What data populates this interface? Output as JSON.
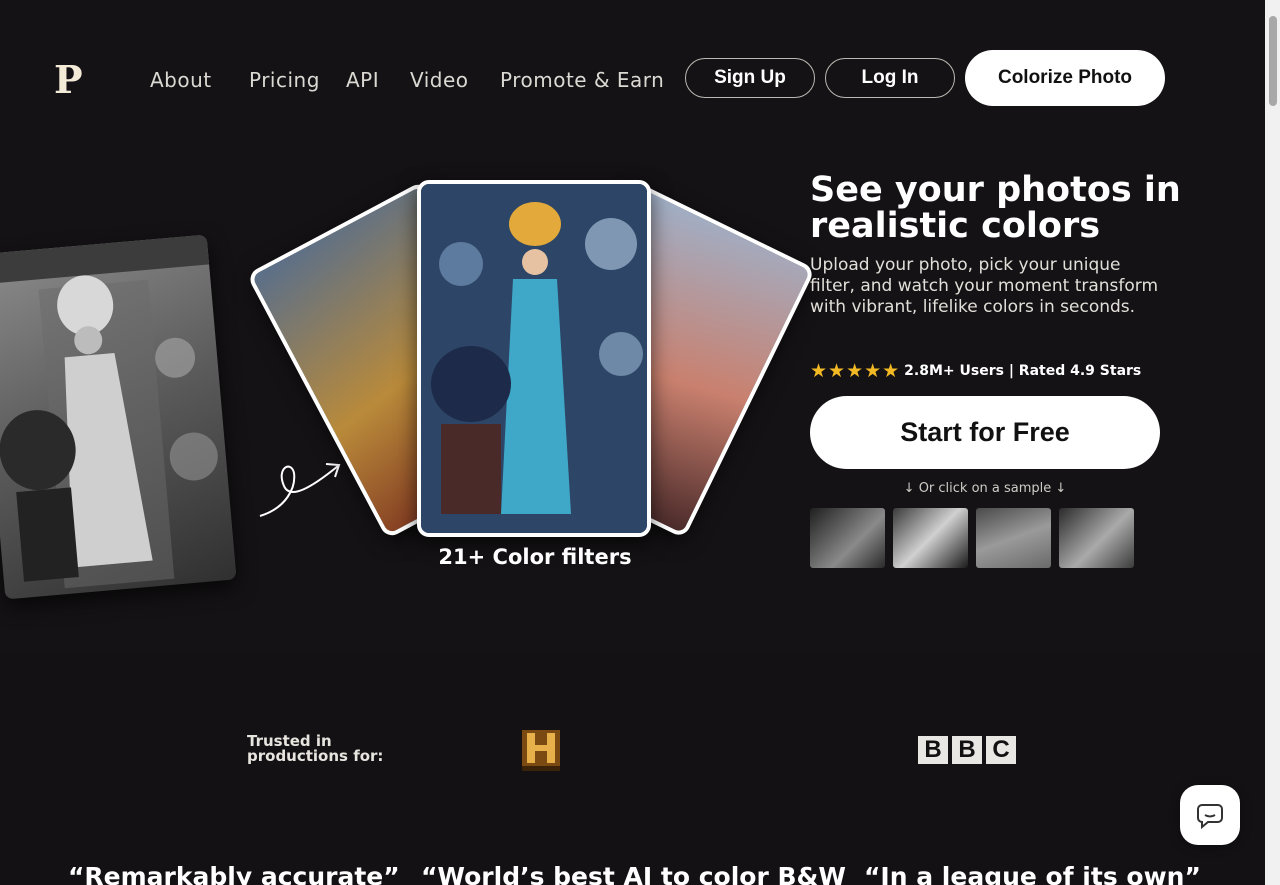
{
  "header": {
    "logo": "P",
    "nav": [
      "About",
      "Pricing",
      "API",
      "Video",
      "Promote & Earn"
    ],
    "signup_label": "Sign Up",
    "login_label": "Log In",
    "cta_label": "Colorize Photo"
  },
  "hero": {
    "title": "See your photos in realistic colors",
    "subtitle": "Upload your photo, pick your unique filter, and watch your moment transform with vibrant, lifelike colors in seconds.",
    "stars": "★★★★★",
    "rating_text": "2.8M+ Users | Rated 4.9 Stars",
    "start_label": "Start for Free",
    "sample_hint": "↓ Or click on a sample ↓",
    "filters_label": "21+ Color filters"
  },
  "trusted": {
    "label": "Trusted in productions for:",
    "bbc": [
      "B",
      "B",
      "C"
    ]
  },
  "quotes": [
    "“Remarkably accurate”",
    "“World’s best AI to color B&W",
    "“In a league of its own”"
  ],
  "icons": [
    "logo-icon",
    "star-icon",
    "arrow-squiggle-icon",
    "history-logo",
    "bbc-logo",
    "chat-icon"
  ],
  "colors": {
    "background": "#141214",
    "text": "#f1eee9",
    "star": "#f2b925",
    "button_bg": "#ffffff"
  }
}
